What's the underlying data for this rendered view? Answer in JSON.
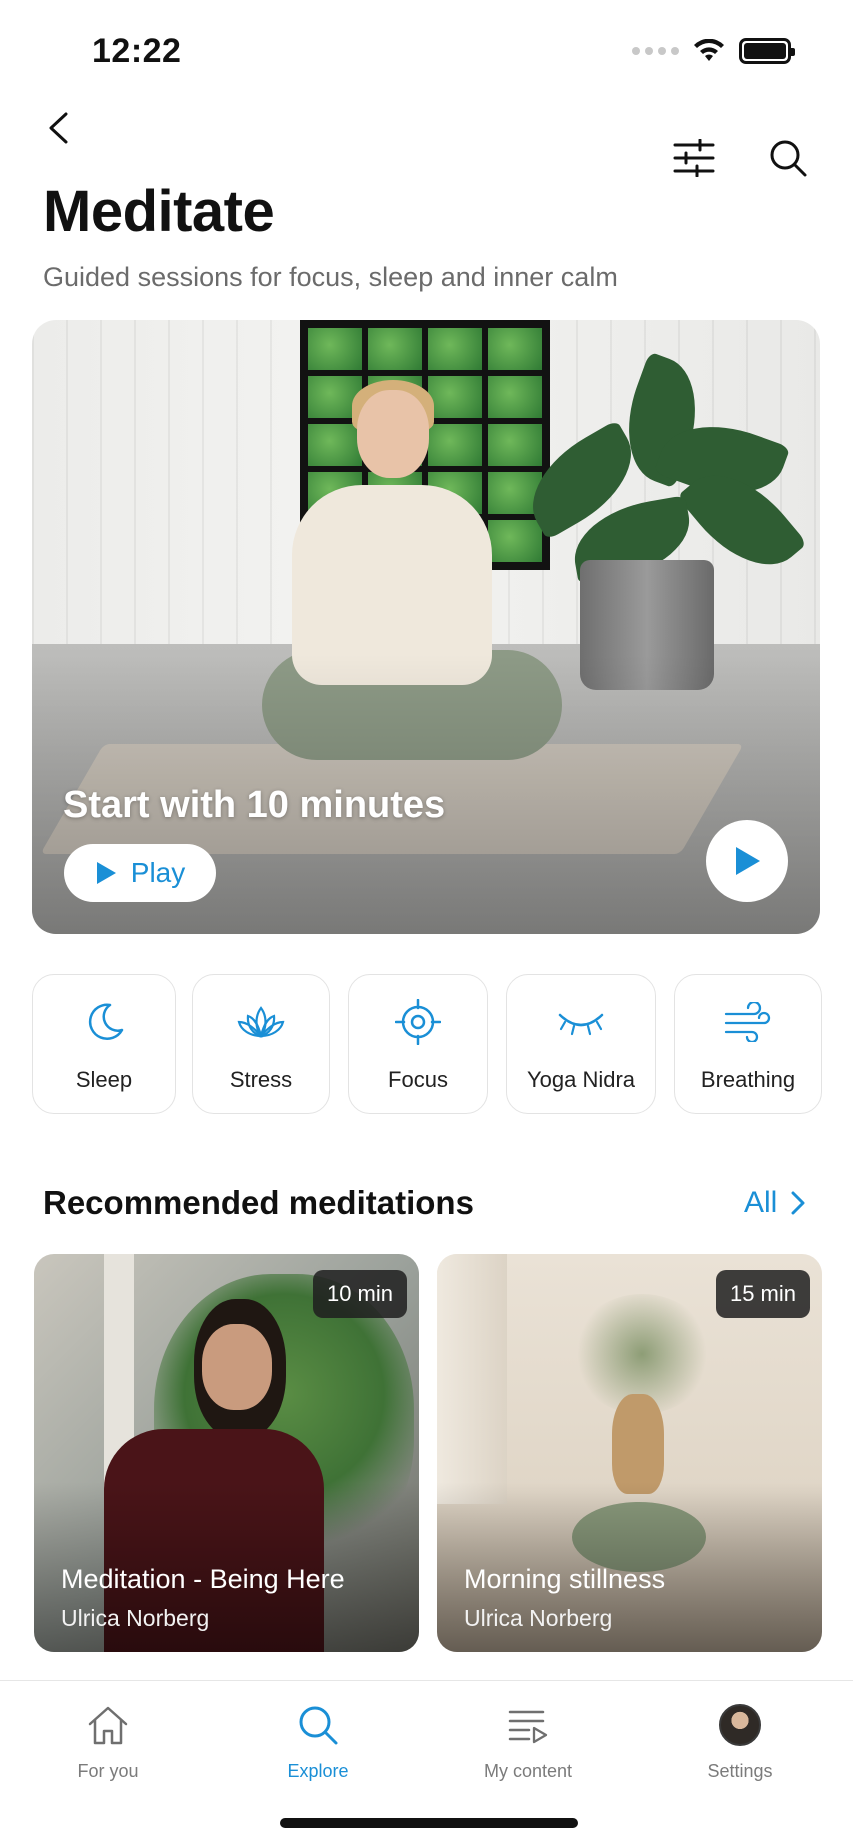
{
  "status_bar": {
    "time": "12:22"
  },
  "header": {
    "title": "Meditate",
    "subtitle": "Guided sessions for focus, sleep and inner calm"
  },
  "hero": {
    "title": "Start with 10 minutes",
    "play_label": "Play"
  },
  "categories": [
    {
      "label": "Sleep",
      "icon": "moon-icon"
    },
    {
      "label": "Stress",
      "icon": "lotus-icon"
    },
    {
      "label": "Focus",
      "icon": "target-icon"
    },
    {
      "label": "Yoga Nidra",
      "icon": "closed-eye-icon"
    },
    {
      "label": "Breathing",
      "icon": "wind-icon"
    }
  ],
  "recommended": {
    "title": "Recommended meditations",
    "all_label": "All",
    "items": [
      {
        "title": "Meditation - Being Here",
        "author": "Ulrica Norberg",
        "duration": "10 min"
      },
      {
        "title": "Morning stillness",
        "author": "Ulrica Norberg",
        "duration": "15 min"
      }
    ]
  },
  "tabs": [
    {
      "label": "For you",
      "icon": "home-icon",
      "active": false
    },
    {
      "label": "Explore",
      "icon": "search-icon",
      "active": true
    },
    {
      "label": "My content",
      "icon": "playlist-icon",
      "active": false
    },
    {
      "label": "Settings",
      "icon": "avatar",
      "active": false
    }
  ],
  "colors": {
    "accent": "#1a8fd6",
    "text": "#111111",
    "muted": "#6b6b6b",
    "border": "#e3e3e3"
  }
}
